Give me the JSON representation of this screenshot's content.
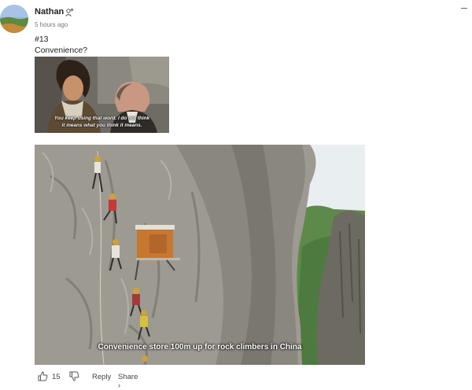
{
  "post": {
    "author": "Nathan",
    "time": "5 hours ago",
    "line1": "#13",
    "line2": "Convenience?",
    "meme_caption_1": "You keep using that word. I do not think",
    "meme_caption_2": "it means what you think it means.",
    "photo_caption": "Convenience store 100m up for rock climbers in China"
  },
  "actions": {
    "upvotes": "15",
    "reply": "Reply",
    "share": "Share ›"
  },
  "icons": {
    "avatar": "avatar-landscape",
    "follow": "add-person-icon",
    "collapse": "minus-icon",
    "upvote": "thumbs-up-icon",
    "downvote": "thumbs-down-icon"
  },
  "colors": {
    "text": "#222222",
    "muted": "#777777",
    "icon": "#555555"
  }
}
